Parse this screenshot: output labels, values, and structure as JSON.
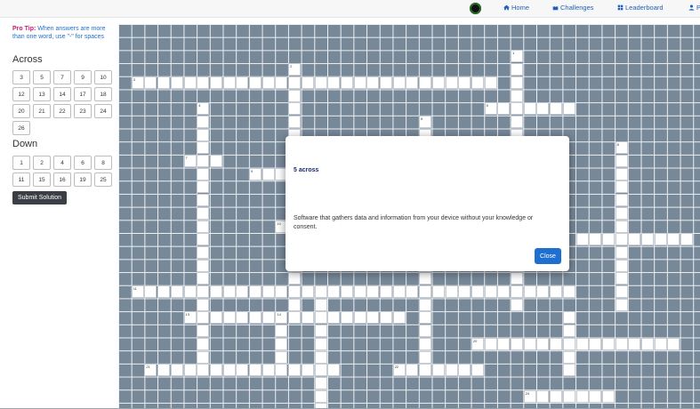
{
  "nav": {
    "home": "Home",
    "challenges": "Challenges",
    "leaderboard": "Leaderboard",
    "profile": "P"
  },
  "tip": {
    "label": "Pro Tip:",
    "text": " When answers are more than one word, use \"-\" for spaces"
  },
  "across": {
    "heading": "Across",
    "items": [
      "3",
      "5",
      "7",
      "9",
      "10",
      "12",
      "13",
      "14",
      "17",
      "18",
      "20",
      "21",
      "22",
      "23",
      "24",
      "26"
    ]
  },
  "down": {
    "heading": "Down",
    "items": [
      "1",
      "2",
      "4",
      "6",
      "8",
      "11",
      "15",
      "16",
      "19",
      "25"
    ]
  },
  "submit_label": "Submit Solution",
  "clue_numbers": [
    "1",
    "2",
    "3",
    "4",
    "5",
    "6",
    "7",
    "8",
    "9",
    "10",
    "11",
    "13",
    "14",
    "15",
    "16",
    "20",
    "21",
    "22",
    "24"
  ],
  "modal": {
    "title": "5 across",
    "body": "Software that gathers data and information from your device without your knowledge or consent.",
    "close": "Close"
  }
}
